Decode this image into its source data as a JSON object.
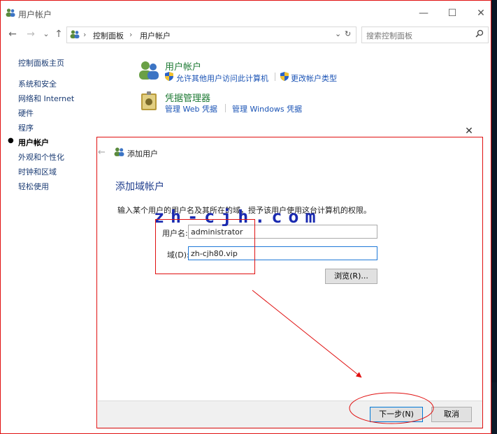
{
  "window": {
    "title": "用户帐户",
    "controls": {
      "minimize": "—",
      "maximize": "☐",
      "close": "✕"
    }
  },
  "nav": {
    "back": "←",
    "forward": "→",
    "dropdown": "⌄",
    "up": "↑",
    "breadcrumb": [
      "控制面板",
      "用户帐户"
    ],
    "search_placeholder": "搜索控制面板"
  },
  "sidebar": {
    "items": [
      {
        "label": "控制面板主页"
      },
      {
        "label": "系统和安全"
      },
      {
        "label": "网络和 Internet"
      },
      {
        "label": "硬件"
      },
      {
        "label": "程序"
      },
      {
        "label": "用户帐户"
      },
      {
        "label": "外观和个性化"
      },
      {
        "label": "时钟和区域"
      },
      {
        "label": "轻松使用"
      }
    ]
  },
  "categories": [
    {
      "title": "用户帐户",
      "links": [
        "允许其他用户访问此计算机",
        "更改帐户类型"
      ]
    },
    {
      "title": "凭据管理器",
      "links": [
        "管理 Web 凭据",
        "管理 Windows 凭据"
      ]
    }
  ],
  "dialog": {
    "close": "✕",
    "back": "←",
    "title": "添加用户",
    "heading": "添加域帐户",
    "instruction": "输入某个用户的用户名及其所在的域，授予该用户使用这台计算机的权限。",
    "username_label": "用户名:",
    "username_value": "administrator",
    "domain_label": "域(D):",
    "domain_value": "zh-cjh80.vip",
    "browse_label": "浏览(R)...",
    "next_label": "下一步(N)",
    "cancel_label": "取消"
  },
  "watermark": "zh-cjh.com"
}
